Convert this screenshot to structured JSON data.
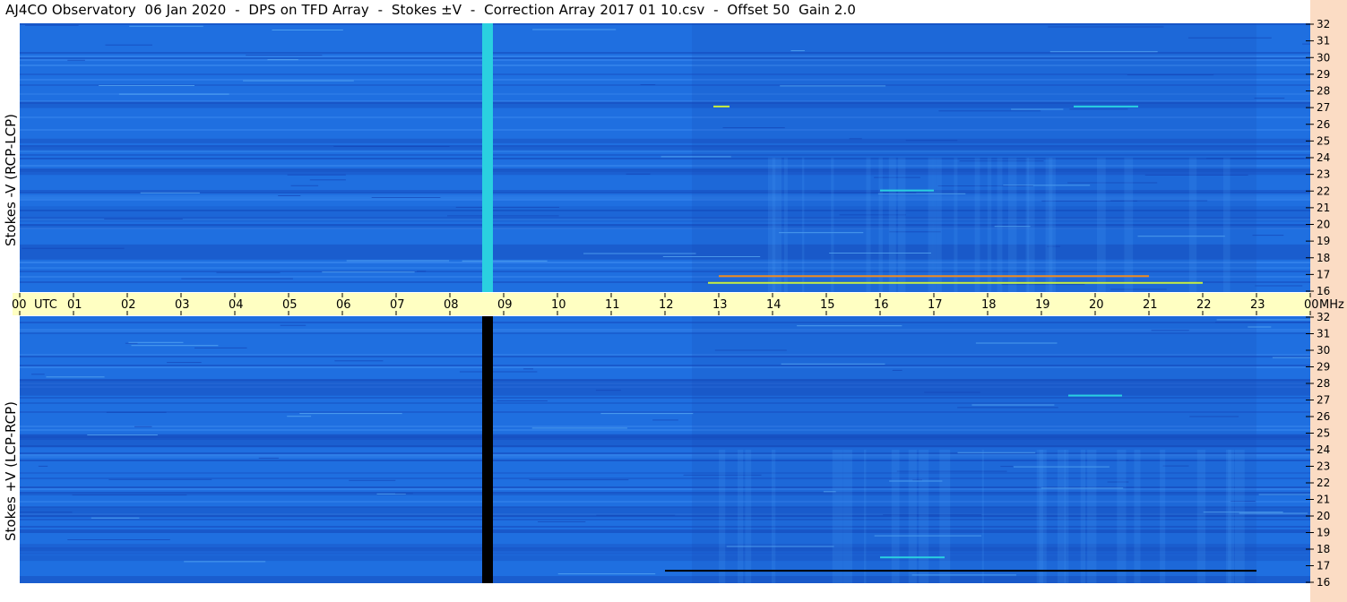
{
  "header": {
    "title": "AJ4CO Observatory  06 Jan 2020  -  DPS on TFD Array  -  Stokes ±V  -  Correction Array 2017 01 10.csv  -  Offset 50  Gain 2.0"
  },
  "colors": {
    "background_blue": "#1f6fe0",
    "deep_blue": "#1446b8",
    "cyan": "#2ad0e0",
    "yellow_green": "#c8f040",
    "orange": "#f08a1e",
    "time_axis_bg": "#ffffc2",
    "right_axis_bg": "#fbdcc4"
  },
  "chart_data": [
    {
      "type": "heatmap",
      "panel": "top",
      "ylabel": "Stokes -V (RCP-LCP)",
      "x_unit": "UTC",
      "y_unit": "MHz",
      "xlim": [
        0,
        24
      ],
      "ylim": [
        16,
        32
      ],
      "y_ticks": [
        "32",
        "31",
        "30",
        "29",
        "28",
        "27",
        "26",
        "25",
        "24",
        "23",
        "22",
        "21",
        "20",
        "19",
        "18",
        "17",
        "16"
      ],
      "gap_band": {
        "start_hour": 8.6,
        "end_hour": 8.8,
        "color": "cyan"
      },
      "notable_features": [
        {
          "start_hour": 12.8,
          "end_hour": 22.0,
          "freq": 16.6,
          "color": "yellow_green"
        },
        {
          "start_hour": 13.0,
          "end_hour": 21.0,
          "freq": 17.0,
          "color": "orange"
        },
        {
          "start_hour": 16.0,
          "end_hour": 17.0,
          "freq": 22.1,
          "color": "cyan"
        },
        {
          "start_hour": 12.9,
          "end_hour": 13.2,
          "freq": 27.1,
          "color": "yellow_green"
        },
        {
          "start_hour": 19.6,
          "end_hour": 20.8,
          "freq": 27.1,
          "color": "cyan"
        }
      ]
    },
    {
      "type": "heatmap",
      "panel": "bottom",
      "ylabel": "Stokes +V (LCP-RCP)",
      "x_unit": "UTC",
      "y_unit": "MHz",
      "xlim": [
        0,
        24
      ],
      "ylim": [
        16,
        32
      ],
      "y_ticks": [
        "32",
        "31",
        "30",
        "29",
        "28",
        "27",
        "26",
        "25",
        "24",
        "23",
        "22",
        "21",
        "20",
        "19",
        "18",
        "17",
        "16"
      ],
      "gap_band": {
        "start_hour": 8.6,
        "end_hour": 8.8,
        "color": "black"
      },
      "notable_features": [
        {
          "start_hour": 12.0,
          "end_hour": 23.0,
          "freq": 16.8,
          "color": "black"
        },
        {
          "start_hour": 16.0,
          "end_hour": 17.2,
          "freq": 17.6,
          "color": "cyan"
        },
        {
          "start_hour": 19.5,
          "end_hour": 20.5,
          "freq": 27.3,
          "color": "cyan"
        }
      ]
    }
  ],
  "time_axis": {
    "labels": [
      "00",
      "01",
      "02",
      "03",
      "04",
      "05",
      "06",
      "07",
      "08",
      "09",
      "10",
      "11",
      "12",
      "13",
      "14",
      "15",
      "16",
      "17",
      "18",
      "19",
      "20",
      "21",
      "22",
      "23",
      "00"
    ],
    "left_unit": "UTC",
    "right_unit": "MHz"
  }
}
